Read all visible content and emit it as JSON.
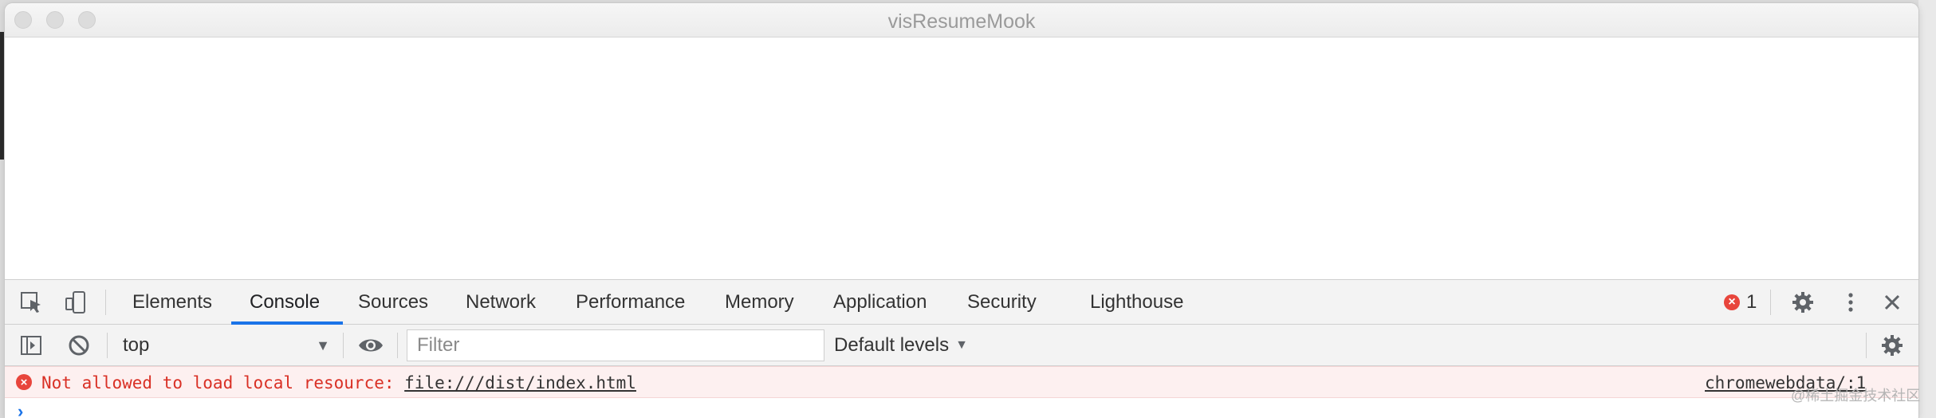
{
  "window": {
    "title": "visResumeMook"
  },
  "devtools": {
    "tabs": [
      {
        "label": "Elements"
      },
      {
        "label": "Console"
      },
      {
        "label": "Sources"
      },
      {
        "label": "Network"
      },
      {
        "label": "Performance"
      },
      {
        "label": "Memory"
      },
      {
        "label": "Application"
      },
      {
        "label": "Security"
      },
      {
        "label": "Lighthouse"
      }
    ],
    "active_tab": "Console",
    "error_count": "1",
    "icons": {
      "inspect": "inspect-element-icon",
      "device": "device-toolbar-icon",
      "settings": "gear-icon",
      "more": "more-vertical-icon",
      "close": "close-icon",
      "error": "error-icon"
    }
  },
  "console": {
    "context": "top",
    "filter_placeholder": "Filter",
    "levels_label": "Default levels",
    "messages": [
      {
        "level": "error",
        "text": "Not allowed to load local resource: ",
        "url": "file:///dist/index.html",
        "source": "chromewebdata/:1"
      }
    ],
    "prompt_symbol": "›"
  },
  "watermark": "@稀土掘金技术社区",
  "colors": {
    "accent": "#1a73e8",
    "error_text": "#d93025",
    "error_bg": "#fdf0f0",
    "error_icon": "#e8453c"
  }
}
